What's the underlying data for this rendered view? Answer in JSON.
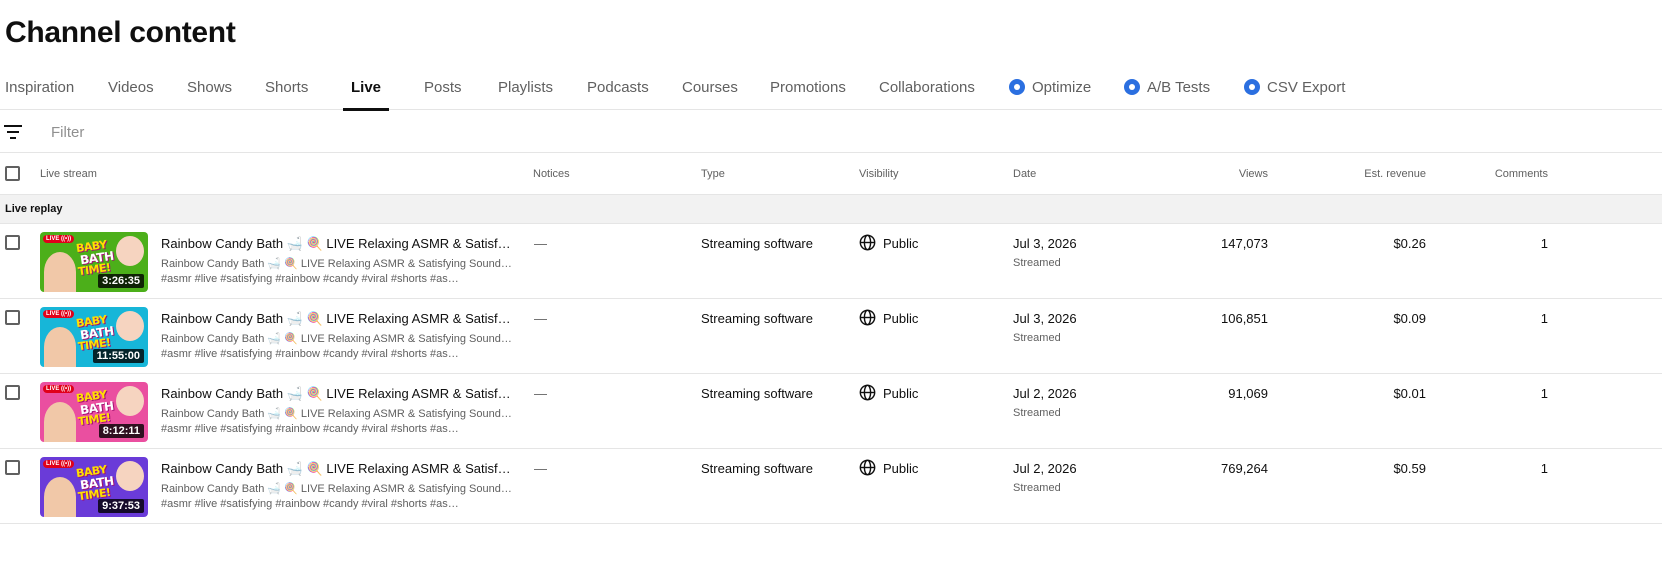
{
  "page": {
    "title": "Channel content"
  },
  "tabs": [
    {
      "label": "Inspiration"
    },
    {
      "label": "Videos"
    },
    {
      "label": "Shows"
    },
    {
      "label": "Shorts"
    },
    {
      "label": "Live",
      "active": true
    },
    {
      "label": "Posts"
    },
    {
      "label": "Playlists"
    },
    {
      "label": "Podcasts"
    },
    {
      "label": "Courses"
    },
    {
      "label": "Promotions"
    },
    {
      "label": "Collaborations"
    },
    {
      "label": "Optimize",
      "icon": "extension-icon"
    },
    {
      "label": "A/B Tests",
      "icon": "extension-icon"
    },
    {
      "label": "CSV Export",
      "icon": "extension-icon"
    }
  ],
  "filter": {
    "placeholder": "Filter",
    "icon": "filter-icon"
  },
  "table": {
    "headers": {
      "live_stream": "Live stream",
      "notices": "Notices",
      "type": "Type",
      "visibility": "Visibility",
      "date": "Date",
      "views": "Views",
      "revenue": "Est. revenue",
      "comments": "Comments"
    },
    "group_label": "Live replay",
    "rows": [
      {
        "duration": "3:26:35",
        "title": "Rainbow Candy Bath 🛁 🍭 LIVE Relaxing ASMR & Satisfying Sounds ✨",
        "desc1": "Rainbow Candy Bath 🛁 🍭 LIVE Relaxing ASMR & Satisfying Sounds ✨",
        "desc2": "#asmr #live #satisfying #rainbow #candy #viral #shorts #asmr…",
        "notices": "—",
        "type": "Streaming software",
        "visibility": "Public",
        "date": "Jul 3, 2026",
        "date_sub": "Streamed",
        "views": "147,073",
        "revenue": "$0.26",
        "comments": "1",
        "thumb_bg": "#4caf1a"
      },
      {
        "duration": "11:55:00",
        "title": "Rainbow Candy Bath 🛁 🍭 LIVE Relaxing ASMR & Satisfying Sounds ✨",
        "desc1": "Rainbow Candy Bath 🛁 🍭 LIVE Relaxing ASMR & Satisfying Sounds ✨",
        "desc2": "#asmr #live #satisfying #rainbow #candy #viral #shorts #asmr…",
        "notices": "—",
        "type": "Streaming software",
        "visibility": "Public",
        "date": "Jul 3, 2026",
        "date_sub": "Streamed",
        "views": "106,851",
        "revenue": "$0.09",
        "comments": "1",
        "thumb_bg": "#17b6d8"
      },
      {
        "duration": "8:12:11",
        "title": "Rainbow Candy Bath 🛁 🍭 LIVE Relaxing ASMR & Satisfying Sounds ✨",
        "desc1": "Rainbow Candy Bath 🛁 🍭 LIVE Relaxing ASMR & Satisfying Sounds ✨",
        "desc2": "#asmr #live #satisfying #rainbow #candy #viral #shorts #asmr…",
        "notices": "—",
        "type": "Streaming software",
        "visibility": "Public",
        "date": "Jul 2, 2026",
        "date_sub": "Streamed",
        "views": "91,069",
        "revenue": "$0.01",
        "comments": "1",
        "thumb_bg": "#ea4fa0"
      },
      {
        "duration": "9:37:53",
        "title": "Rainbow Candy Bath 🛁 🍭 LIVE Relaxing ASMR & Satisfying Sounds ✨",
        "desc1": "Rainbow Candy Bath 🛁 🍭 LIVE Relaxing ASMR & Satisfying Sounds ✨",
        "desc2": "#asmr #live #satisfying #rainbow #candy #viral #shorts #asmr…",
        "notices": "—",
        "type": "Streaming software",
        "visibility": "Public",
        "date": "Jul 2, 2026",
        "date_sub": "Streamed",
        "views": "769,264",
        "revenue": "$0.59",
        "comments": "1",
        "thumb_bg": "#6a3bd8"
      }
    ]
  },
  "thumbnail_text": {
    "live": "LIVE ((•))",
    "line1": "BABY",
    "line2": "BATH",
    "line3": "TIME!"
  },
  "colors": {
    "accent_icon": "#2b6fe0",
    "live_badge": "#e0001a",
    "group_bg": "#f2f2f2"
  }
}
